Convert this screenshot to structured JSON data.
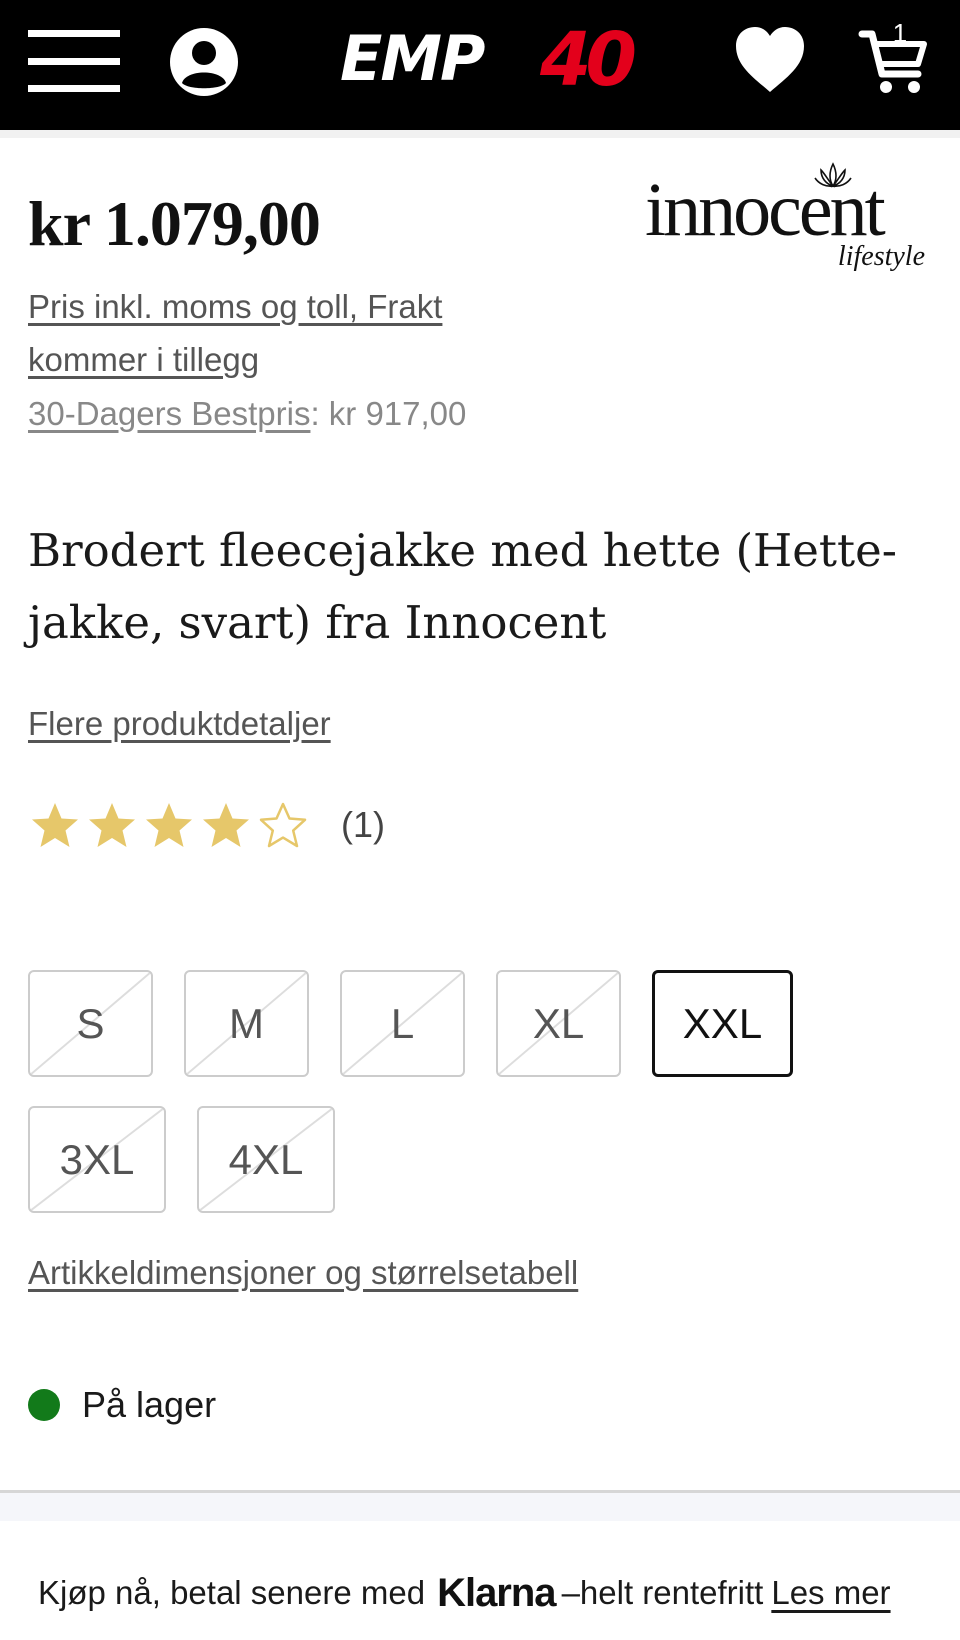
{
  "header": {
    "logo_text": "EMP",
    "logo_number": "40",
    "cart_count": "1",
    "logo_color": "#e3001b"
  },
  "product": {
    "price": "kr 1.079,00",
    "brand_name": "innocent",
    "brand_sub": "lifestyle",
    "tax_note": "Pris inkl. moms og toll, Frakt kommer i tillegg",
    "bestpris_label": "30-Dagers Bestpris",
    "bestpris_value": ": kr 917,00",
    "title": "Brodert fleecejakke med hette (Hette-jakke, svart) fra Innocent",
    "details_link": "Flere produktdetaljer",
    "rating": {
      "stars_filled": 4,
      "stars_total": 5,
      "count": "(1)",
      "star_color": "#e6c76a"
    },
    "sizes": [
      {
        "label": "S",
        "available": false
      },
      {
        "label": "M",
        "available": false
      },
      {
        "label": "L",
        "available": false
      },
      {
        "label": "XL",
        "available": false
      },
      {
        "label": "XXL",
        "available": true
      },
      {
        "label": "3XL",
        "available": false
      },
      {
        "label": "4XL",
        "available": false
      }
    ],
    "size_chart_link": "Artikkeldimensjoner og størrelsetabell",
    "stock_text": "På lager",
    "stock_color": "#127a1a"
  },
  "klarna": {
    "prefix": "Kjøp nå, betal senere med",
    "brand": "Klarna",
    "suffix": "–helt rentefritt",
    "link": "Les mer"
  }
}
